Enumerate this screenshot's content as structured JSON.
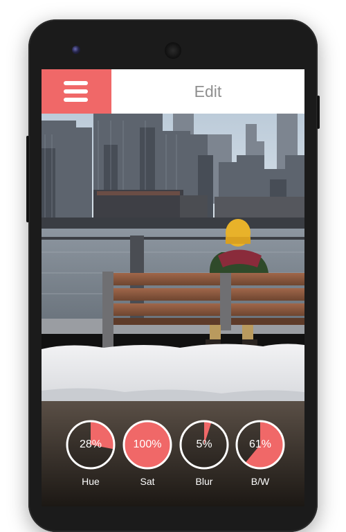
{
  "header": {
    "title": "Edit",
    "menu_icon": "hamburger-menu-icon"
  },
  "photo": {
    "description_icon": "photo-canvas"
  },
  "colors": {
    "accent": "#f06868",
    "title_text": "#8f8f8f",
    "control_text": "#ffffff"
  },
  "controls": [
    {
      "name": "Hue",
      "value_text": "28%",
      "value": 0.28
    },
    {
      "name": "Sat",
      "value_text": "100%",
      "value": 1.0
    },
    {
      "name": "Blur",
      "value_text": "5%",
      "value": 0.05
    },
    {
      "name": "B/W",
      "value_text": "61%",
      "value": 0.61
    }
  ]
}
